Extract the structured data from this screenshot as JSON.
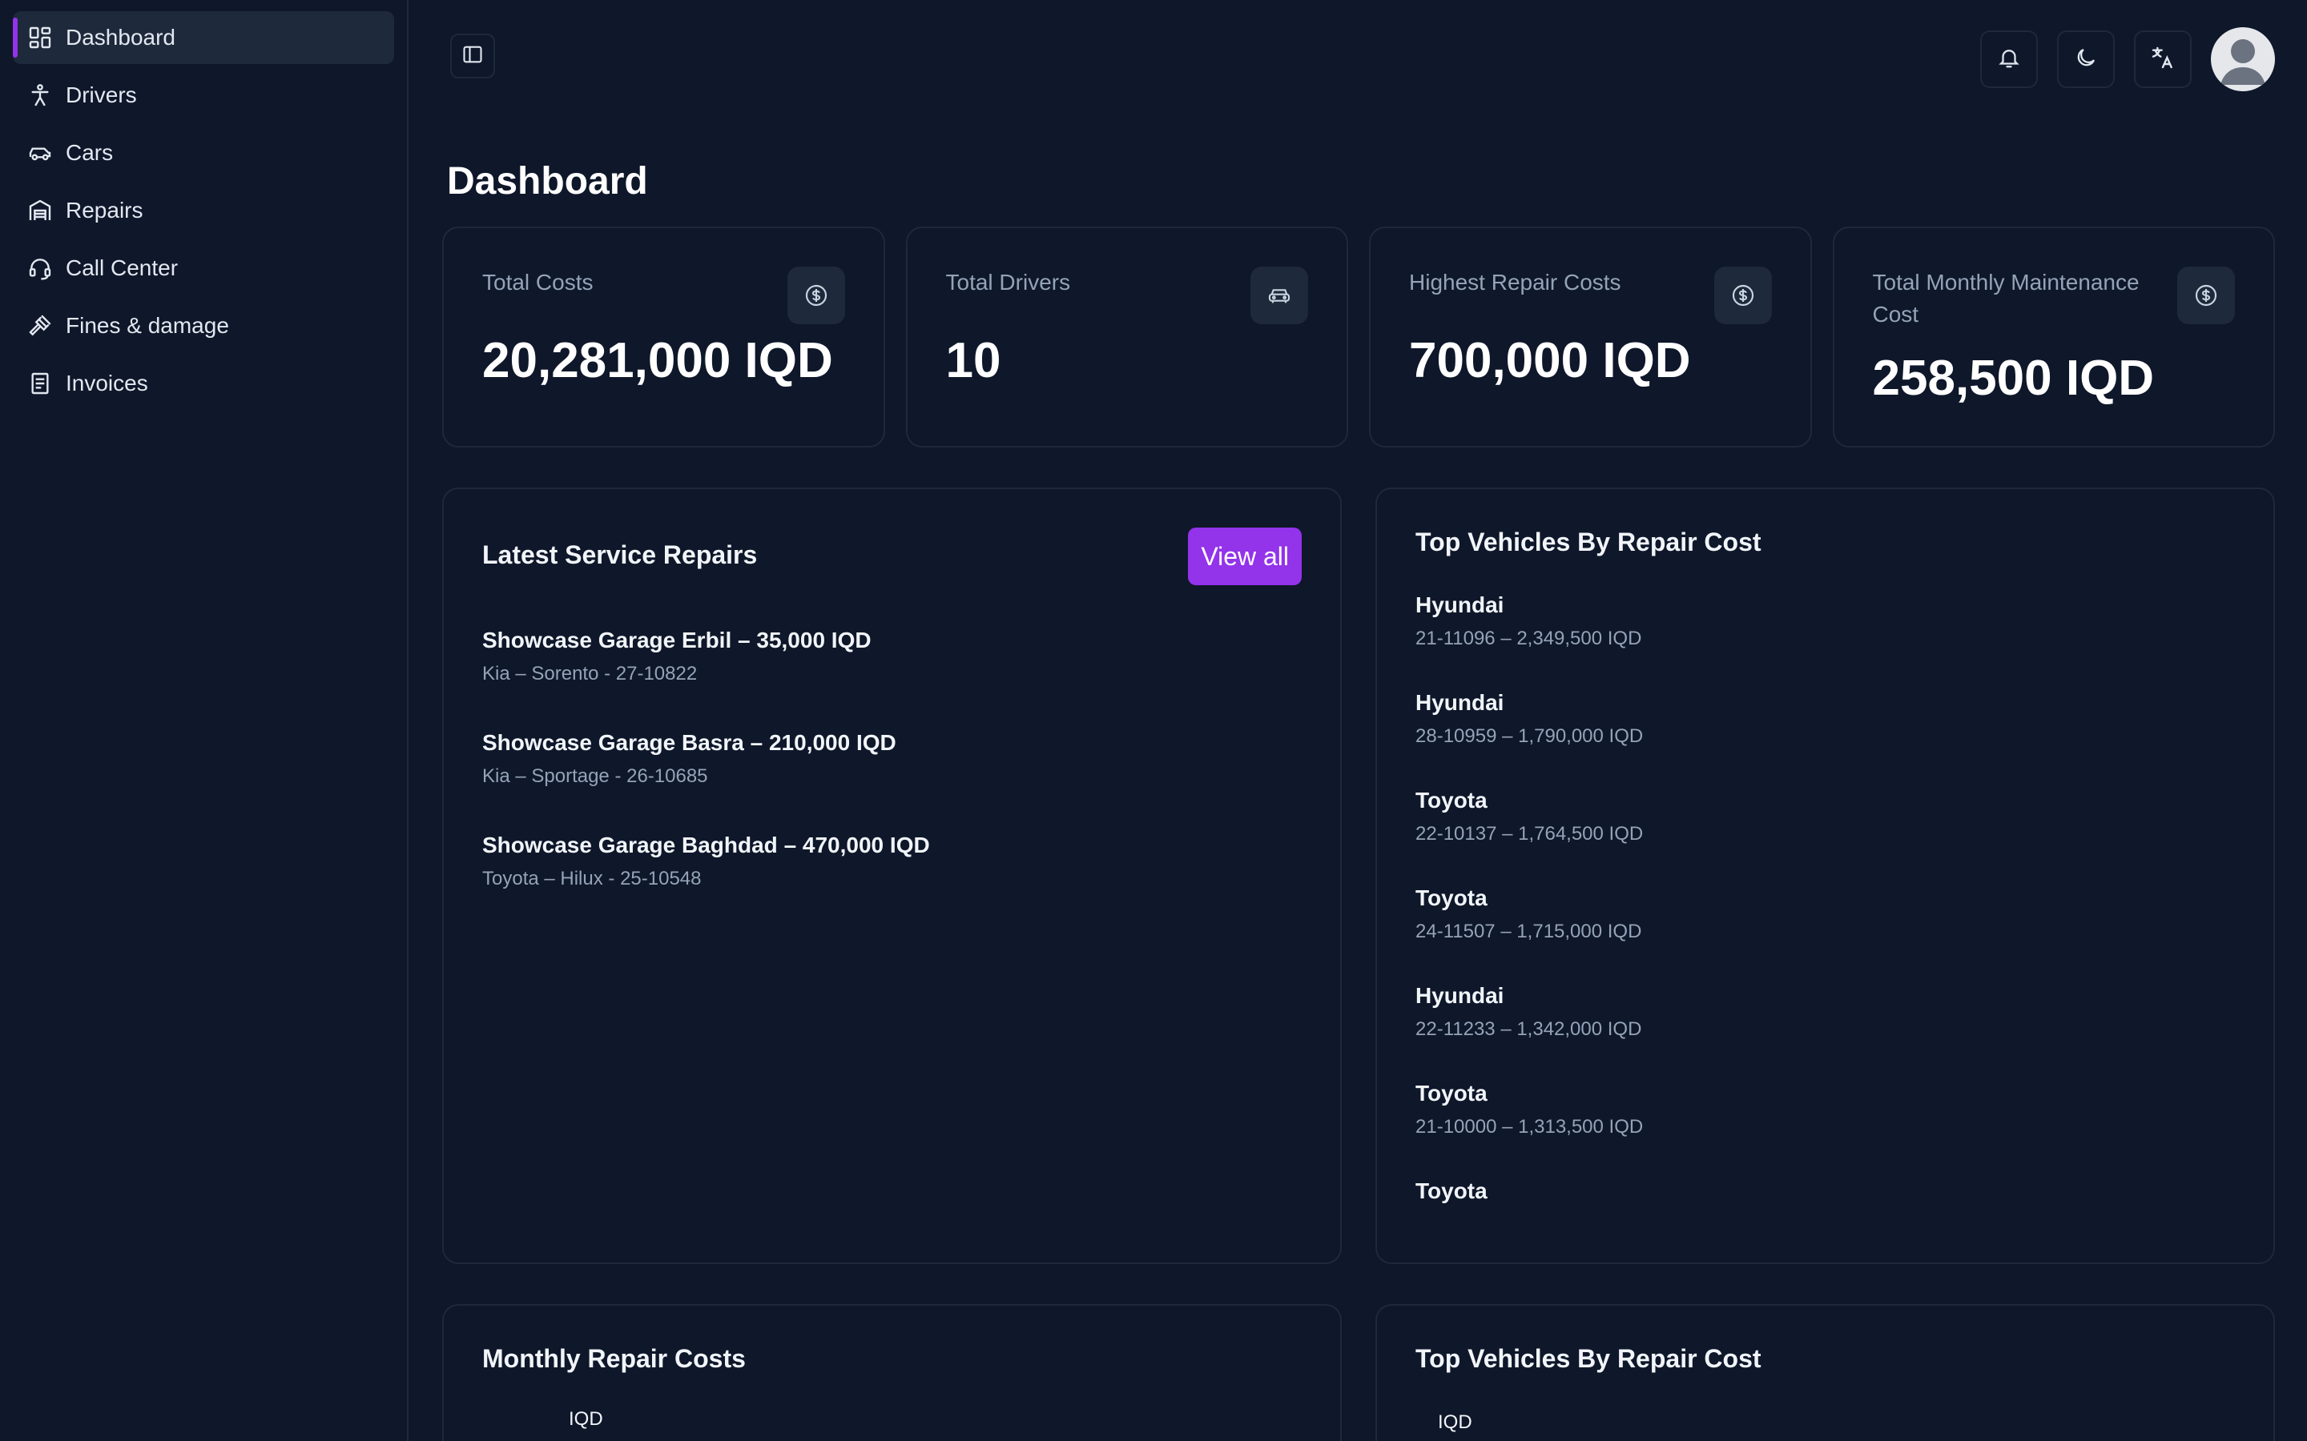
{
  "sidebar": {
    "items": [
      {
        "label": "Dashboard",
        "icon": "dashboard-icon",
        "active": true
      },
      {
        "label": "Drivers",
        "icon": "person-icon"
      },
      {
        "label": "Cars",
        "icon": "car-icon"
      },
      {
        "label": "Repairs",
        "icon": "garage-icon"
      },
      {
        "label": "Call Center",
        "icon": "headset-icon"
      },
      {
        "label": "Fines & damage",
        "icon": "gavel-icon"
      },
      {
        "label": "Invoices",
        "icon": "invoice-icon"
      }
    ]
  },
  "header": {
    "actions": [
      "bell-icon",
      "moon-icon",
      "translate-icon",
      "avatar"
    ]
  },
  "page": {
    "title": "Dashboard"
  },
  "stats": [
    {
      "label": "Total Costs",
      "value": "20,281,000 IQD",
      "icon": "dollar-circle-icon"
    },
    {
      "label": "Total Drivers",
      "value": "10",
      "icon": "car-icon"
    },
    {
      "label": "Highest Repair Costs",
      "value": "700,000 IQD",
      "icon": "dollar-circle-icon"
    },
    {
      "label": "Total Monthly Maintenance Cost",
      "value": "258,500 IQD",
      "icon": "dollar-circle-icon"
    }
  ],
  "latest_repairs": {
    "title": "Latest Service Repairs",
    "view_all": "View all",
    "items": [
      {
        "title": "Showcase Garage Erbil – 35,000 IQD",
        "sub": "Kia – Sorento - 27-10822"
      },
      {
        "title": "Showcase Garage Basra – 210,000 IQD",
        "sub": "Kia – Sportage - 26-10685"
      },
      {
        "title": "Showcase Garage Baghdad – 470,000 IQD",
        "sub": "Toyota – Hilux - 25-10548"
      }
    ]
  },
  "top_vehicles": {
    "title": "Top Vehicles By Repair Cost",
    "items": [
      {
        "brand": "Hyundai",
        "sub": "21-11096 – 2,349,500 IQD"
      },
      {
        "brand": "Hyundai",
        "sub": "28-10959 – 1,790,000 IQD"
      },
      {
        "brand": "Toyota",
        "sub": "22-10137 – 1,764,500 IQD"
      },
      {
        "brand": "Toyota",
        "sub": "24-11507 – 1,715,000 IQD"
      },
      {
        "brand": "Hyundai",
        "sub": "22-11233 – 1,342,000 IQD"
      },
      {
        "brand": "Toyota",
        "sub": "21-10000 – 1,313,500 IQD"
      },
      {
        "brand": "Toyota",
        "sub": ""
      }
    ]
  },
  "monthly_chart": {
    "title": "Monthly Repair Costs",
    "axis_hint": "IQD"
  },
  "top_vehicles_chart": {
    "title": "Top Vehicles By Repair Cost",
    "axis_hint": "IQD"
  }
}
